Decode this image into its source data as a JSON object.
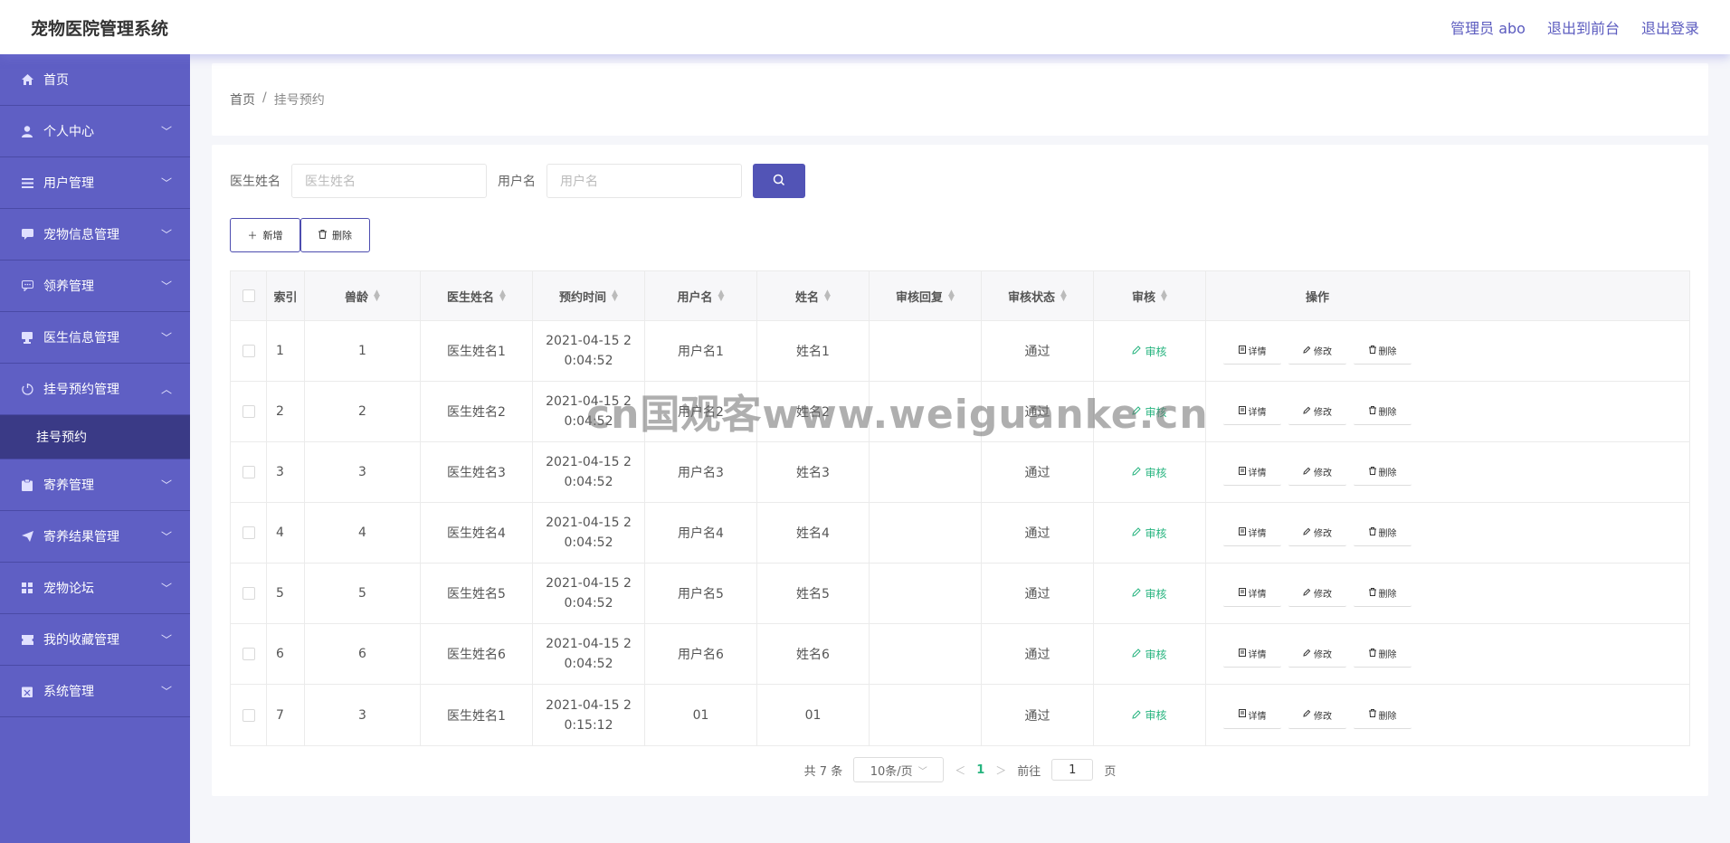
{
  "header": {
    "title": "宠物医院管理系统",
    "links": [
      "管理员 abo",
      "退出到前台",
      "退出登录"
    ]
  },
  "sidebar": {
    "items": [
      {
        "label": "首页",
        "icon": "home-icon",
        "arrow": ""
      },
      {
        "label": "个人中心",
        "icon": "user-icon",
        "arrow": "down"
      },
      {
        "label": "用户管理",
        "icon": "list-icon",
        "arrow": "down"
      },
      {
        "label": "宠物信息管理",
        "icon": "chat-icon",
        "arrow": "down"
      },
      {
        "label": "领养管理",
        "icon": "message-icon",
        "arrow": "down"
      },
      {
        "label": "医生信息管理",
        "icon": "cup-icon",
        "arrow": "down"
      },
      {
        "label": "挂号预约管理",
        "icon": "clock-icon",
        "arrow": "up"
      },
      {
        "label": "寄养管理",
        "icon": "clipboard-icon",
        "arrow": "down"
      },
      {
        "label": "寄养结果管理",
        "icon": "send-icon",
        "arrow": "down"
      },
      {
        "label": "宠物论坛",
        "icon": "grid-icon",
        "arrow": "down"
      },
      {
        "label": "我的收藏管理",
        "icon": "ticket-icon",
        "arrow": "down"
      },
      {
        "label": "系统管理",
        "icon": "box-icon",
        "arrow": "down"
      }
    ],
    "submenu_active": "挂号预约"
  },
  "breadcrumb": {
    "home": "首页",
    "sep": "/",
    "current": "挂号预约"
  },
  "filters": {
    "doctor_label": "医生姓名",
    "doctor_placeholder": "医生姓名",
    "user_label": "用户名",
    "user_placeholder": "用户名"
  },
  "actions": {
    "add": "新增",
    "delete": "删除"
  },
  "table": {
    "columns": [
      "索引",
      "兽龄",
      "医生姓名",
      "预约时间",
      "用户名",
      "姓名",
      "审核回复",
      "审核状态",
      "审核",
      "操作"
    ],
    "rows": [
      {
        "index": "1",
        "age": "1",
        "doctor": "医生姓名1",
        "time": "2021-04-15 20:04:52",
        "username": "用户名1",
        "name": "姓名1",
        "reply": "",
        "status": "通过"
      },
      {
        "index": "2",
        "age": "2",
        "doctor": "医生姓名2",
        "time": "2021-04-15 20:04:52",
        "username": "用户名2",
        "name": "姓名2",
        "reply": "",
        "status": "通过"
      },
      {
        "index": "3",
        "age": "3",
        "doctor": "医生姓名3",
        "time": "2021-04-15 20:04:52",
        "username": "用户名3",
        "name": "姓名3",
        "reply": "",
        "status": "通过"
      },
      {
        "index": "4",
        "age": "4",
        "doctor": "医生姓名4",
        "time": "2021-04-15 20:04:52",
        "username": "用户名4",
        "name": "姓名4",
        "reply": "",
        "status": "通过"
      },
      {
        "index": "5",
        "age": "5",
        "doctor": "医生姓名5",
        "time": "2021-04-15 20:04:52",
        "username": "用户名5",
        "name": "姓名5",
        "reply": "",
        "status": "通过"
      },
      {
        "index": "6",
        "age": "6",
        "doctor": "医生姓名6",
        "time": "2021-04-15 20:04:52",
        "username": "用户名6",
        "name": "姓名6",
        "reply": "",
        "status": "通过"
      },
      {
        "index": "7",
        "age": "3",
        "doctor": "医生姓名1",
        "time": "2021-04-15 20:15:12",
        "username": "01",
        "name": "01",
        "reply": "",
        "status": "通过"
      }
    ],
    "review_label": "审核",
    "ops": {
      "detail": "详情",
      "edit": "修改",
      "delete": "删除"
    }
  },
  "pagination": {
    "total": "共 7 条",
    "page_size": "10条/页",
    "current": "1",
    "goto_label": "前往",
    "goto_value": "1",
    "page_unit": "页"
  },
  "watermark": "cn国观客www.weiguanke.cn",
  "colors": {
    "sidebar_bg": "#5f5fc4",
    "sidebar_active": "#3a3a86",
    "accent": "#5254b6",
    "success": "#27b47f"
  }
}
